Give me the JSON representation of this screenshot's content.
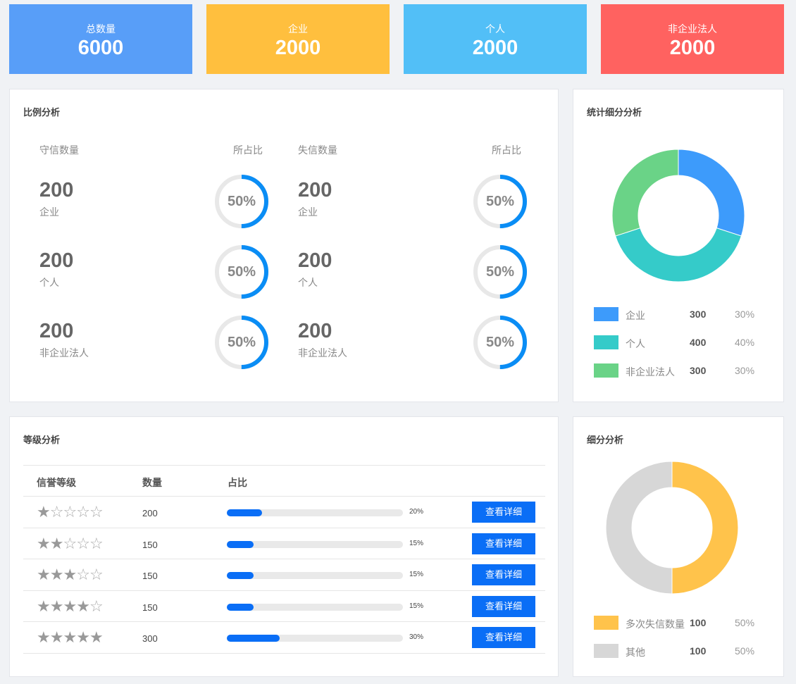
{
  "stats": [
    {
      "label": "总数量",
      "value": "6000",
      "color": "#589ef8"
    },
    {
      "label": "企业",
      "value": "2000",
      "color": "#ffbf3e"
    },
    {
      "label": "个人",
      "value": "2000",
      "color": "#52bff7"
    },
    {
      "label": "非企业法人",
      "value": "2000",
      "color": "#ff6260"
    }
  ],
  "ratio": {
    "title": "比例分析",
    "trust_label": "守信数量",
    "distrust_label": "失信数量",
    "share_label": "所占比",
    "trust": [
      {
        "count": "200",
        "category": "企业",
        "percent": "50%",
        "fraction": 0.5
      },
      {
        "count": "200",
        "category": "个人",
        "percent": "50%",
        "fraction": 0.5
      },
      {
        "count": "200",
        "category": "非企业法人",
        "percent": "50%",
        "fraction": 0.5
      }
    ],
    "distrust": [
      {
        "count": "200",
        "category": "企业",
        "percent": "50%",
        "fraction": 0.5
      },
      {
        "count": "200",
        "category": "个人",
        "percent": "50%",
        "fraction": 0.5
      },
      {
        "count": "200",
        "category": "非企业法人",
        "percent": "50%",
        "fraction": 0.5
      }
    ]
  },
  "stat_detail": {
    "title": "统计细分分析",
    "legend": [
      {
        "label": "企业",
        "value": "300",
        "percent": "30%",
        "color": "#3d9bfb"
      },
      {
        "label": "个人",
        "value": "400",
        "percent": "40%",
        "color": "#35cbc9"
      },
      {
        "label": "非企业法人",
        "value": "300",
        "percent": "30%",
        "color": "#6ad387"
      }
    ]
  },
  "grade": {
    "title": "等级分析",
    "headers": [
      "信誉等级",
      "数量",
      "占比"
    ],
    "button_label": "查看详细",
    "rows": [
      {
        "stars": 1,
        "count": "200",
        "percent": "20%",
        "fraction": 0.2
      },
      {
        "stars": 2,
        "count": "150",
        "percent": "15%",
        "fraction": 0.15
      },
      {
        "stars": 3,
        "count": "150",
        "percent": "15%",
        "fraction": 0.15
      },
      {
        "stars": 4,
        "count": "150",
        "percent": "15%",
        "fraction": 0.15
      },
      {
        "stars": 5,
        "count": "300",
        "percent": "30%",
        "fraction": 0.3
      }
    ]
  },
  "detail": {
    "title": "细分分析",
    "legend": [
      {
        "label": "多次失信数量",
        "value": "100",
        "percent": "50%",
        "color": "#ffc34b"
      },
      {
        "label": "其他",
        "value": "100",
        "percent": "50%",
        "color": "#d7d7d7"
      }
    ]
  },
  "chart_data": [
    {
      "type": "pie",
      "title": "统计细分分析",
      "categories": [
        "企业",
        "个人",
        "非企业法人"
      ],
      "values": [
        300,
        400,
        300
      ],
      "colors": [
        "#3d9bfb",
        "#35cbc9",
        "#6ad387"
      ]
    },
    {
      "type": "pie",
      "title": "细分分析",
      "categories": [
        "多次失信数量",
        "其他"
      ],
      "values": [
        100,
        100
      ],
      "colors": [
        "#ffc34b",
        "#d7d7d7"
      ]
    }
  ]
}
